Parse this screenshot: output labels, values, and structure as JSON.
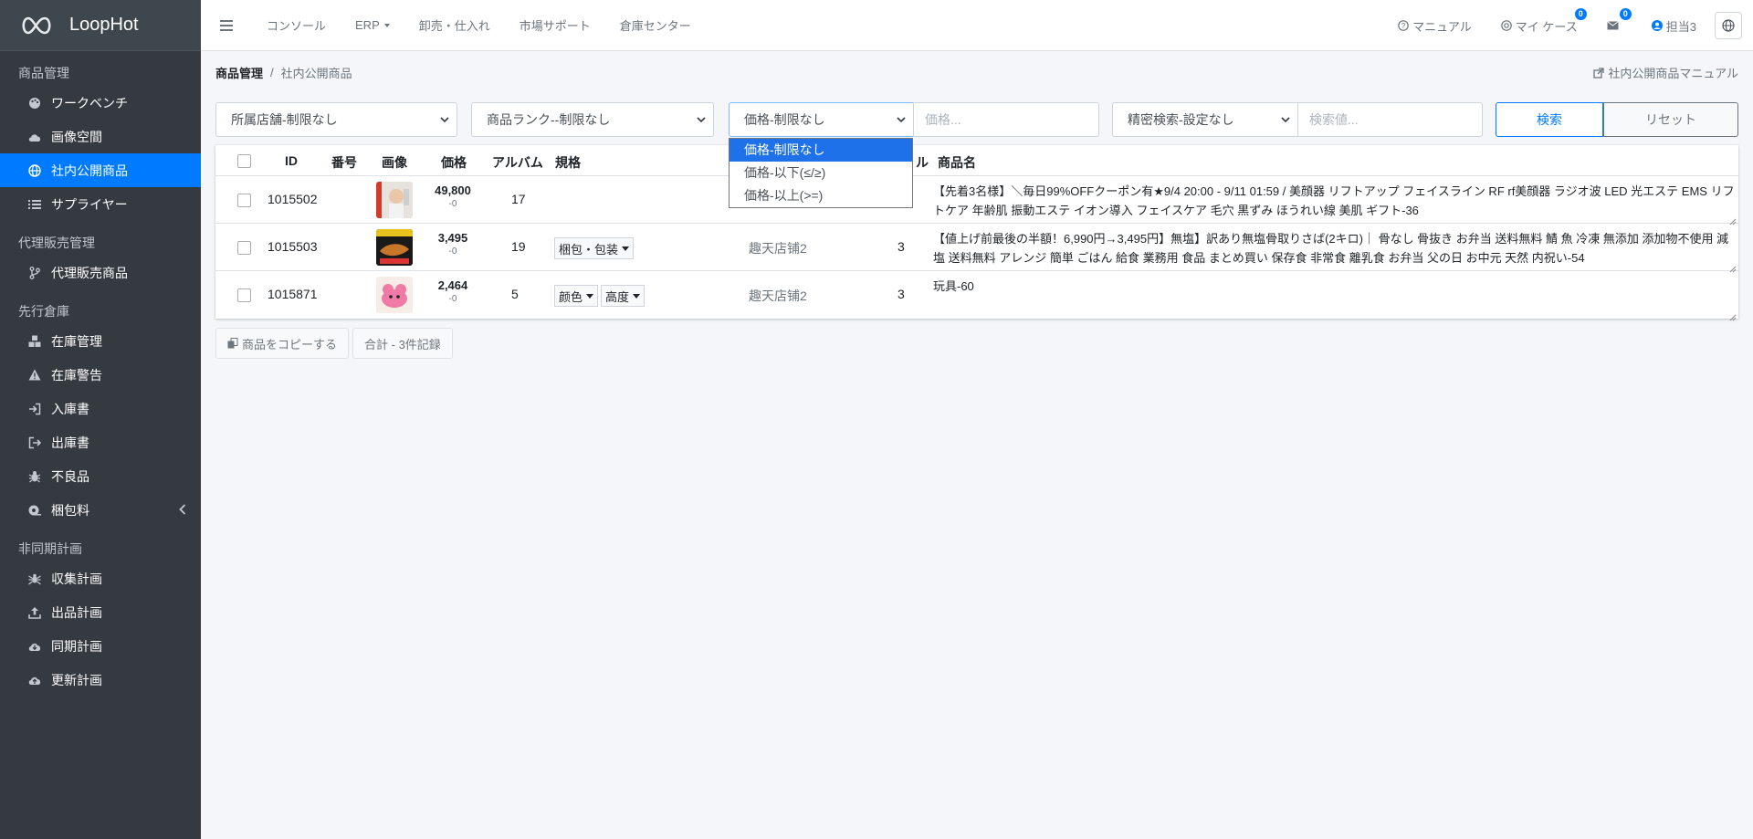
{
  "brand": {
    "name": "LoopHot"
  },
  "sidebar": {
    "sections": [
      {
        "header": "商品管理",
        "items": [
          {
            "label": "ワークベンチ",
            "icon": "palette-icon"
          },
          {
            "label": "画像空間",
            "icon": "cloud-icon"
          },
          {
            "label": "社内公開商品",
            "icon": "globe-icon",
            "active": true
          },
          {
            "label": "サプライヤー",
            "icon": "list-icon"
          }
        ]
      },
      {
        "header": "代理販売管理",
        "items": [
          {
            "label": "代理販売商品",
            "icon": "branch-icon"
          }
        ]
      },
      {
        "header": "先行倉庫",
        "items": [
          {
            "label": "在庫管理",
            "icon": "cubes-icon"
          },
          {
            "label": "在庫警告",
            "icon": "warning-icon"
          },
          {
            "label": "入庫書",
            "icon": "sign-in-icon"
          },
          {
            "label": "出庫書",
            "icon": "sign-out-icon"
          },
          {
            "label": "不良品",
            "icon": "bug-icon"
          },
          {
            "label": "梱包料",
            "icon": "tape-icon"
          }
        ]
      },
      {
        "header": "非同期計画",
        "items": [
          {
            "label": "収集計画",
            "icon": "spider-icon"
          },
          {
            "label": "出品計画",
            "icon": "upload-icon"
          },
          {
            "label": "同期計画",
            "icon": "cloud-download-icon"
          },
          {
            "label": "更新計画",
            "icon": "cloud-upload-icon"
          }
        ]
      }
    ]
  },
  "topbar": {
    "nav": [
      "コンソール",
      "ERP",
      "卸売・仕入れ",
      "市場サポート",
      "倉庫センター"
    ],
    "manual": "マニュアル",
    "my_case": "マイ ケース",
    "my_case_badge": "0",
    "mail_badge": "0",
    "user": "担当3"
  },
  "breadcrumb": {
    "root": "商品管理",
    "current": "社内公開商品",
    "manual_link": "社内公開商品マニュアル"
  },
  "filters": {
    "store": "所属店舗-制限なし",
    "rank": "商品ランク--制限なし",
    "price_mode": "価格-制限なし",
    "price_placeholder": "価格...",
    "advanced": "精密検索-設定なし",
    "search_placeholder": "検索値...",
    "search_btn": "検索",
    "reset_btn": "リセット"
  },
  "price_dropdown": [
    "価格-制限なし",
    "価格-以下(≤/≥)",
    "価格-以上(>=)"
  ],
  "table": {
    "headers": {
      "id": "ID",
      "number": "番号",
      "image": "画像",
      "price": "価格",
      "album": "アルバム",
      "spec": "規格",
      "partial": "ル",
      "name": "商品名"
    },
    "rows": [
      {
        "id": "1015502",
        "price": "49,800",
        "delta": "-0",
        "album": "17",
        "specs": [],
        "store": "",
        "count": "",
        "name": "【先着3名様】＼毎日99%OFFクーポン有★9/4 20:00 - 9/11 01:59 / 美顔器 リフトアップ フェイスライン RF rf美顔器 ラジオ波 LED 光エステ EMS リフトケア 年齢肌 振動エステ イオン導入 フェイスケア 毛穴 黒ずみ ほうれい線 美肌 ギフト-36",
        "thumb": "face"
      },
      {
        "id": "1015503",
        "price": "3,495",
        "delta": "-0",
        "album": "19",
        "specs": [
          "梱包・包装"
        ],
        "store": "趣天店铺2",
        "count": "3",
        "name": "【値上げ前最後の半額！6,990円→3,495円】無塩】訳あり無塩骨取りさば(2キロ)｜ 骨なし 骨抜き お弁当 送料無料 鯖 魚 冷凍 無添加 添加物不使用 減塩 送料無料 アレンジ 簡単 ごはん 給食 業務用 食品 まとめ買い 保存食 非常食 離乳食 お弁当 父の日 お中元 天然 内祝い-54",
        "thumb": "fish"
      },
      {
        "id": "1015871",
        "price": "2,464",
        "delta": "-0",
        "album": "5",
        "specs": [
          "颜色",
          "高度"
        ],
        "store": "趣天店铺2",
        "count": "3",
        "name": "玩具-60",
        "thumb": "toy"
      }
    ]
  },
  "bottom": {
    "copy_btn": "商品をコピーする",
    "total": "合計 - 3件記録"
  }
}
